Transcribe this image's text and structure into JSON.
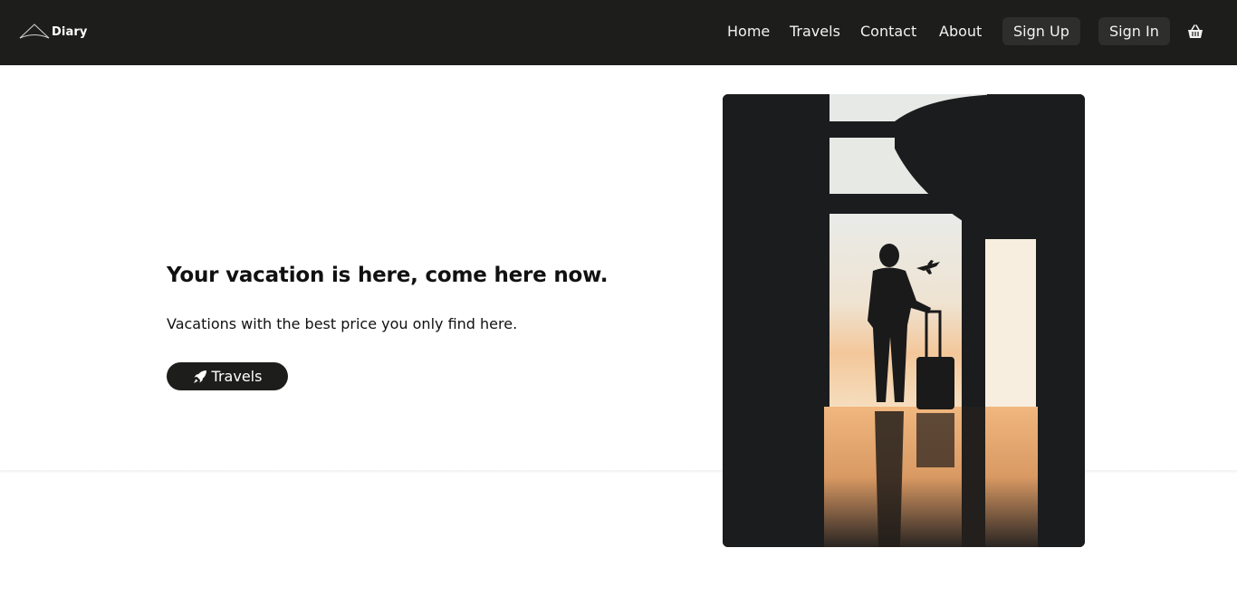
{
  "brand": {
    "name": "Diary",
    "icon": "mountain-logo-icon"
  },
  "nav": {
    "links": [
      "Home",
      "Travels",
      "Contact",
      "About"
    ],
    "signup_label": "Sign Up",
    "signin_label": "Sign In",
    "cart_icon": "basket-icon"
  },
  "hero": {
    "title": "Your vacation is here, come here now.",
    "subtitle": "Vacations with the best price you only find here.",
    "button_label": "Travels",
    "button_icon": "rocket-icon",
    "image": "traveler-silhouette-at-airport-window"
  },
  "colors": {
    "nav_bg": "#1d1d1b",
    "button_bg": "#1d1d1b",
    "text": "#111111",
    "nav_button_bg": "#2e2e2c"
  }
}
